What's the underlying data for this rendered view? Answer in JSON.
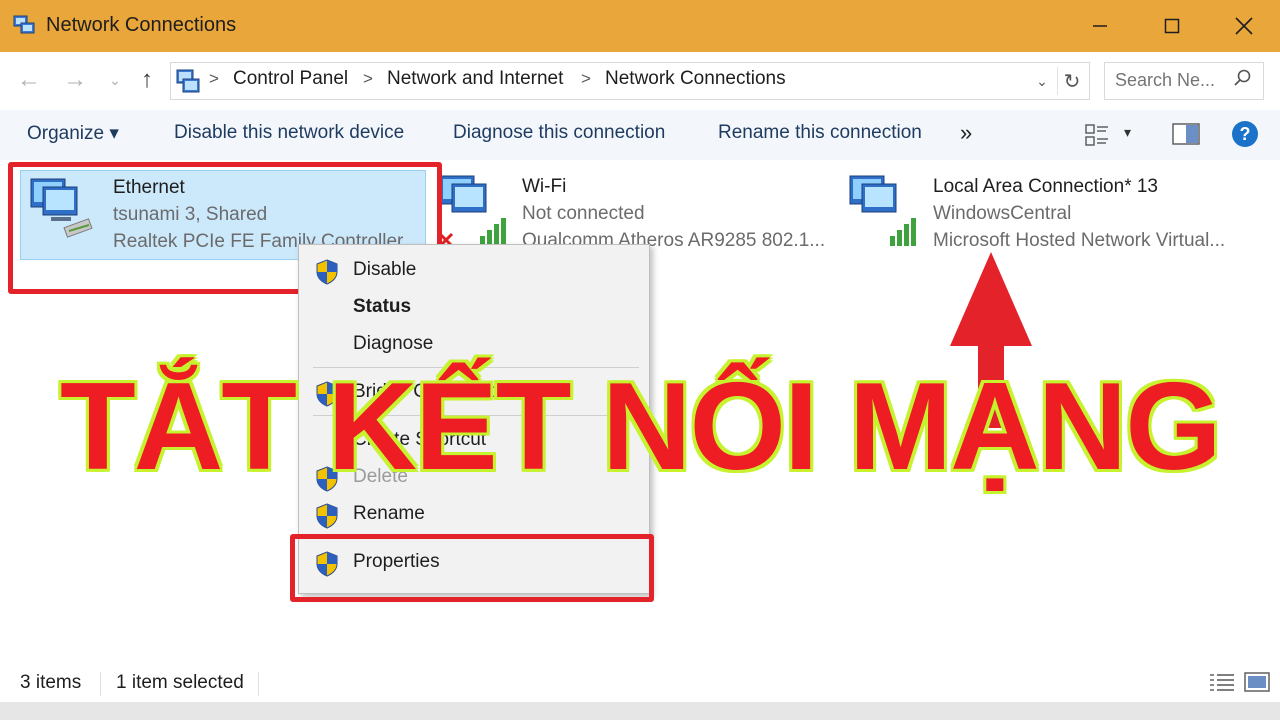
{
  "window": {
    "title": "Network Connections",
    "accent": "#e9a63a"
  },
  "controls": {
    "minimize_icon": "minimize-icon",
    "maximize_icon": "maximize-icon",
    "close_icon": "close-icon"
  },
  "nav": {
    "back": "←",
    "forward": "→",
    "recent": "⌄",
    "up": "↑"
  },
  "address": {
    "separator": ">",
    "crumbs": [
      "Control Panel",
      "Network and Internet",
      "Network Connections"
    ],
    "dropdown": "⌄",
    "refresh": "↻"
  },
  "search": {
    "placeholder": "Search Ne..."
  },
  "command_bar": {
    "organize": "Organize ▾",
    "disable": "Disable this network device",
    "diagnose": "Diagnose this connection",
    "rename": "Rename this connection",
    "more": "»",
    "view_drop": "▾",
    "help": "?"
  },
  "items": [
    {
      "name": "Ethernet",
      "status": "tsunami  3, Shared",
      "device": "Realtek PCIe FE Family Controller",
      "selected": true
    },
    {
      "name": "Wi-Fi",
      "status": "Not connected",
      "device": "Qualcomm Atheros AR9285 802.1...",
      "selected": false
    },
    {
      "name": "Local Area Connection* 13",
      "status": "WindowsCentral",
      "device": "Microsoft Hosted Network Virtual...",
      "selected": false
    }
  ],
  "context_menu": [
    {
      "label": "Disable",
      "icon": "uac-shield-icon"
    },
    {
      "label": "Status"
    },
    {
      "label": "Diagnose"
    },
    {
      "label": "Bridge Connections",
      "icon": "uac-shield-icon"
    },
    {
      "label": "Create Shortcut"
    },
    {
      "label": "Delete",
      "icon": "uac-shield-icon"
    },
    {
      "label": "Rename",
      "icon": "uac-shield-icon"
    },
    {
      "label": "Properties",
      "icon": "uac-shield-icon"
    }
  ],
  "overlay": {
    "text": "TẮT KẾT NỐI MẠNG",
    "text_color": "#ee1c23",
    "outline_color": "#c6f22e",
    "highlight_color": "#e3222a"
  },
  "status_bar": {
    "count": "3 items",
    "selection": "1 item selected"
  }
}
